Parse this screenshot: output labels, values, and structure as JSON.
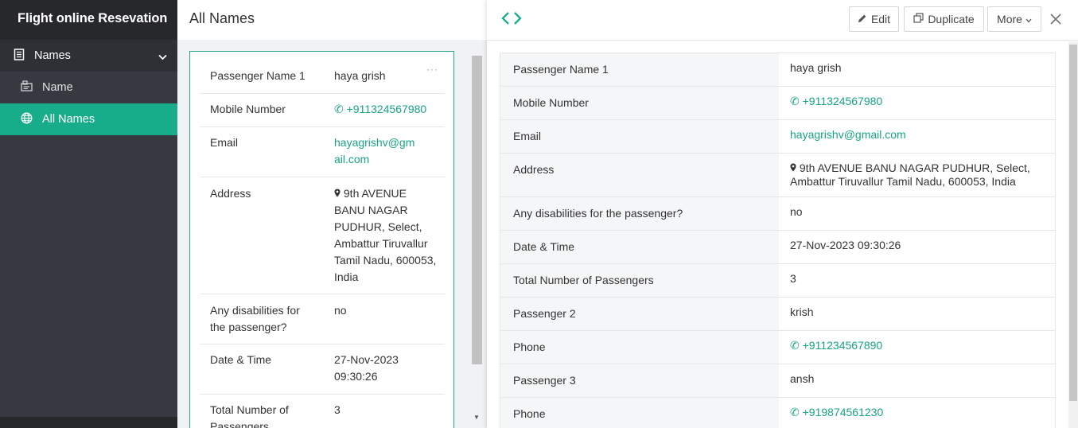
{
  "app": {
    "title": "Flight online Resevation"
  },
  "sidebar": {
    "group": {
      "label": "Names",
      "icon": "form-icon"
    },
    "items": [
      {
        "label": "Name",
        "icon": "form-entry-icon",
        "active": false
      },
      {
        "label": "All Names",
        "icon": "globe-icon",
        "active": true
      }
    ]
  },
  "list": {
    "title": "All Names",
    "card": {
      "more": "···",
      "rows": [
        {
          "key": "Passenger Name 1",
          "value": "haya grish"
        },
        {
          "key": "Mobile Number",
          "value": "+911324567980"
        },
        {
          "key": "Email",
          "value": "hayagrishv@gmail.com"
        },
        {
          "key": "Address",
          "value": "9th AVENUE BANU NAGAR PUDHUR, Select, Ambattur Tiruvallur Tamil Nadu, 600053, India"
        },
        {
          "key": "Any disabilities for the passenger?",
          "value": "no"
        },
        {
          "key": "Date & Time",
          "value": "27-Nov-2023 09:30:26"
        },
        {
          "key": "Total Number of Passengers",
          "value": "3"
        }
      ]
    }
  },
  "detail": {
    "toolbar": {
      "edit": "Edit",
      "duplicate": "Duplicate",
      "more": "More"
    },
    "rows": [
      {
        "key": "Passenger Name 1",
        "value": "haya grish"
      },
      {
        "key": "Mobile Number",
        "value": "+911324567980"
      },
      {
        "key": "Email",
        "value": "hayagrishv@gmail.com"
      },
      {
        "key": "Address",
        "value": "9th AVENUE BANU NAGAR PUDHUR, Select, Ambattur Tiruvallur Tamil Nadu, 600053, India"
      },
      {
        "key": "Any disabilities for the passenger?",
        "value": "no"
      },
      {
        "key": "Date & Time",
        "value": "27-Nov-2023 09:30:26"
      },
      {
        "key": "Total Number of Passengers",
        "value": "3"
      },
      {
        "key": "Passenger 2",
        "value": "krish"
      },
      {
        "key": "Phone",
        "value": "+911234567890"
      },
      {
        "key": "Passenger 3",
        "value": "ansh"
      },
      {
        "key": "Phone",
        "value": "+919874561230"
      }
    ]
  },
  "colors": {
    "accent": "#17ad8b",
    "link": "#17a585",
    "sidebar": "#363940",
    "sidebar_header": "#26282c"
  }
}
